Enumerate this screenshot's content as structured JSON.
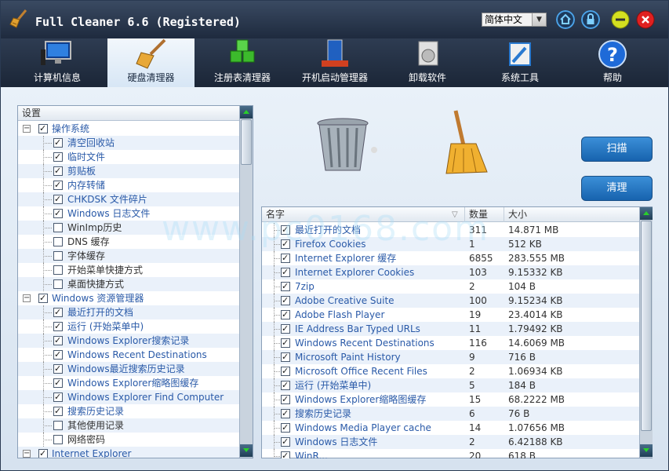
{
  "app": {
    "title": "Full Cleaner 6.6 (Registered)",
    "language": "简体中文"
  },
  "tabs": [
    {
      "label": "计算机信息",
      "icon": "computer-icon"
    },
    {
      "label": "硬盘清理器",
      "icon": "broom-icon"
    },
    {
      "label": "注册表清理器",
      "icon": "registry-cubes-icon"
    },
    {
      "label": "开机启动管理器",
      "icon": "startup-manager-icon"
    },
    {
      "label": "卸载软件",
      "icon": "uninstall-icon"
    },
    {
      "label": "系统工具",
      "icon": "system-tools-icon"
    },
    {
      "label": "帮助",
      "icon": "help-icon"
    }
  ],
  "settings": {
    "header": "设置",
    "items": [
      {
        "label": "操作系统",
        "level": 0,
        "checked": true
      },
      {
        "label": "清空回收站",
        "level": 1,
        "checked": true
      },
      {
        "label": "临时文件",
        "level": 1,
        "checked": true
      },
      {
        "label": "剪贴板",
        "level": 1,
        "checked": true
      },
      {
        "label": "内存转储",
        "level": 1,
        "checked": true
      },
      {
        "label": "CHKDSK 文件碎片",
        "level": 1,
        "checked": true
      },
      {
        "label": "Windows 日志文件",
        "level": 1,
        "checked": true
      },
      {
        "label": "WinImp历史",
        "level": 1,
        "checked": false
      },
      {
        "label": "DNS 缓存",
        "level": 1,
        "checked": false
      },
      {
        "label": "字体缓存",
        "level": 1,
        "checked": false
      },
      {
        "label": "开始菜单快捷方式",
        "level": 1,
        "checked": false
      },
      {
        "label": "桌面快捷方式",
        "level": 1,
        "checked": false
      },
      {
        "label": "Windows 资源管理器",
        "level": 0,
        "checked": true
      },
      {
        "label": "最近打开的文档",
        "level": 1,
        "checked": true
      },
      {
        "label": "运行 (开始菜单中)",
        "level": 1,
        "checked": true
      },
      {
        "label": "Windows Explorer搜索记录",
        "level": 1,
        "checked": true
      },
      {
        "label": "Windows Recent Destinations",
        "level": 1,
        "checked": true
      },
      {
        "label": "Windows最近搜索历史记录",
        "level": 1,
        "checked": true
      },
      {
        "label": "Windows Explorer缩略图缓存",
        "level": 1,
        "checked": true
      },
      {
        "label": "Windows Explorer Find Computer",
        "level": 1,
        "checked": true
      },
      {
        "label": "搜索历史记录",
        "level": 1,
        "checked": true
      },
      {
        "label": "其他使用记录",
        "level": 1,
        "checked": false
      },
      {
        "label": "网络密码",
        "level": 1,
        "checked": false
      },
      {
        "label": "Internet Explorer",
        "level": 0,
        "checked": true
      }
    ]
  },
  "buttons": {
    "scan": "扫描",
    "clean": "清理"
  },
  "results": {
    "columns": {
      "name": "名字",
      "count": "数量",
      "size": "大小"
    },
    "rows": [
      {
        "name": "最近打开的文档",
        "count": "311",
        "size": "14.871 MB"
      },
      {
        "name": "Firefox Cookies",
        "count": "1",
        "size": "512 KB"
      },
      {
        "name": "Internet Explorer 缓存",
        "count": "6855",
        "size": "283.555 MB"
      },
      {
        "name": "Internet Explorer Cookies",
        "count": "103",
        "size": "9.15332 KB"
      },
      {
        "name": "7zip",
        "count": "2",
        "size": "104 B"
      },
      {
        "name": "Adobe Creative Suite",
        "count": "100",
        "size": "9.15234 KB"
      },
      {
        "name": "Adobe Flash Player",
        "count": "19",
        "size": "23.4014 KB"
      },
      {
        "name": "IE Address Bar Typed URLs",
        "count": "11",
        "size": "1.79492 KB"
      },
      {
        "name": "Windows Recent Destinations",
        "count": "116",
        "size": "14.6069 MB"
      },
      {
        "name": "Microsoft Paint History",
        "count": "9",
        "size": "716 B"
      },
      {
        "name": "Microsoft Office Recent Files",
        "count": "2",
        "size": "1.06934 KB"
      },
      {
        "name": "运行 (开始菜单中)",
        "count": "5",
        "size": "184 B"
      },
      {
        "name": "Windows Explorer缩略图缓存",
        "count": "15",
        "size": "68.2222 MB"
      },
      {
        "name": "搜索历史记录",
        "count": "6",
        "size": "76 B"
      },
      {
        "name": "Windows Media Player cache",
        "count": "14",
        "size": "1.07656 MB"
      },
      {
        "name": "Windows 日志文件",
        "count": "2",
        "size": "6.42188 KB"
      },
      {
        "name": "WinR...",
        "count": "20",
        "size": "618 B"
      }
    ]
  },
  "watermark": "www.pc0168.com"
}
